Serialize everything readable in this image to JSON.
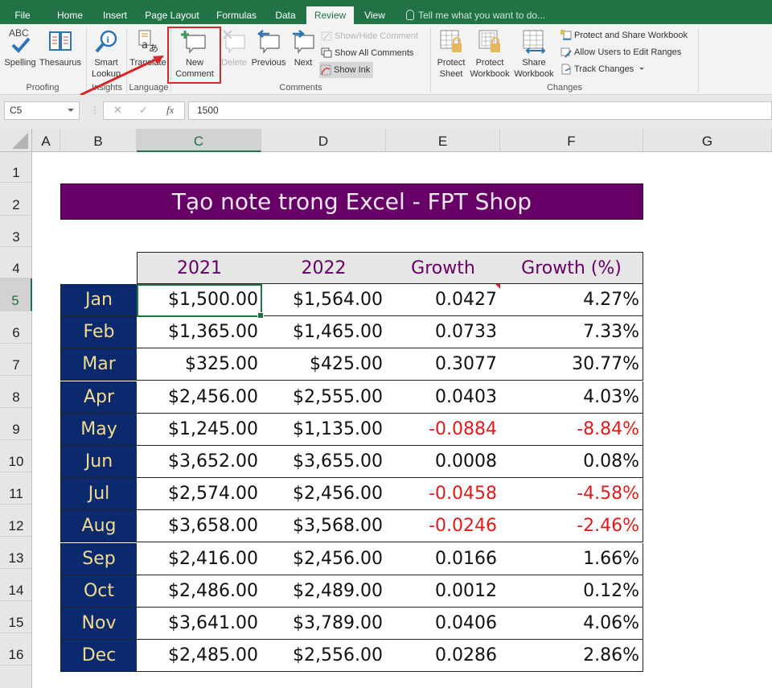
{
  "ribbon_tabs": [
    {
      "label": "File",
      "active": false
    },
    {
      "label": "Home",
      "active": false
    },
    {
      "label": "Insert",
      "active": false
    },
    {
      "label": "Page Layout",
      "active": false
    },
    {
      "label": "Formulas",
      "active": false
    },
    {
      "label": "Data",
      "active": false
    },
    {
      "label": "Review",
      "active": true
    },
    {
      "label": "View",
      "active": false
    }
  ],
  "tell_me": "Tell me what you want to do...",
  "ribbon": {
    "proofing": {
      "label": "Proofing",
      "spelling": "Spelling",
      "abc": "ABC",
      "thesaurus": "Thesaurus"
    },
    "insights": {
      "label": "Insights",
      "smart_lookup_1": "Smart",
      "smart_lookup_2": "Lookup"
    },
    "language": {
      "label": "Language",
      "translate": "Translate"
    },
    "comments": {
      "label": "Comments",
      "new_comment_1": "New",
      "new_comment_2": "Comment",
      "delete": "Delete",
      "previous": "Previous",
      "next": "Next",
      "show_hide": "Show/Hide Comment",
      "show_all": "Show All Comments",
      "show_ink": "Show Ink"
    },
    "changes": {
      "label": "Changes",
      "protect_sheet_1": "Protect",
      "protect_sheet_2": "Sheet",
      "protect_workbook_1": "Protect",
      "protect_workbook_2": "Workbook",
      "share_workbook_1": "Share",
      "share_workbook_2": "Workbook",
      "protect_share": "Protect and Share Workbook",
      "allow_users": "Allow Users to Edit Ranges",
      "track_changes": "Track Changes"
    }
  },
  "formula_bar": {
    "name_box": "C5",
    "cancel": "✕",
    "enter": "✓",
    "fx": "fx",
    "value": "1500"
  },
  "columns": [
    "A",
    "B",
    "C",
    "D",
    "E",
    "F",
    "G"
  ],
  "selected_column": "C",
  "rows": [
    "1",
    "2",
    "3",
    "4",
    "5",
    "6",
    "7",
    "8",
    "9",
    "10",
    "11",
    "12",
    "13",
    "14",
    "15",
    "16"
  ],
  "selected_row": "5",
  "sheet": {
    "title": "Tạo note trong Excel - FPT Shop",
    "headers": [
      "2021",
      "2022",
      "Growth",
      "Growth (%)"
    ],
    "data": [
      {
        "month": "Jan",
        "y2021": "$1,500.00",
        "y2022": "$1,564.00",
        "growth": "0.0427",
        "growth_pct": "4.27%",
        "negative": false
      },
      {
        "month": "Feb",
        "y2021": "$1,365.00",
        "y2022": "$1,465.00",
        "growth": "0.0733",
        "growth_pct": "7.33%",
        "negative": false
      },
      {
        "month": "Mar",
        "y2021": "$325.00",
        "y2022": "$425.00",
        "growth": "0.3077",
        "growth_pct": "30.77%",
        "negative": false
      },
      {
        "month": "Apr",
        "y2021": "$2,456.00",
        "y2022": "$2,555.00",
        "growth": "0.0403",
        "growth_pct": "4.03%",
        "negative": false
      },
      {
        "month": "May",
        "y2021": "$1,245.00",
        "y2022": "$1,135.00",
        "growth": "-0.0884",
        "growth_pct": "-8.84%",
        "negative": true
      },
      {
        "month": "Jun",
        "y2021": "$3,652.00",
        "y2022": "$3,655.00",
        "growth": "0.0008",
        "growth_pct": "0.08%",
        "negative": false
      },
      {
        "month": "Jul",
        "y2021": "$2,574.00",
        "y2022": "$2,456.00",
        "growth": "-0.0458",
        "growth_pct": "-4.58%",
        "negative": true
      },
      {
        "month": "Aug",
        "y2021": "$3,658.00",
        "y2022": "$3,568.00",
        "growth": "-0.0246",
        "growth_pct": "-2.46%",
        "negative": true
      },
      {
        "month": "Sep",
        "y2021": "$2,416.00",
        "y2022": "$2,456.00",
        "growth": "0.0166",
        "growth_pct": "1.66%",
        "negative": false
      },
      {
        "month": "Oct",
        "y2021": "$2,486.00",
        "y2022": "$2,489.00",
        "growth": "0.0012",
        "growth_pct": "0.12%",
        "negative": false
      },
      {
        "month": "Nov",
        "y2021": "$3,641.00",
        "y2022": "$3,789.00",
        "growth": "0.0406",
        "growth_pct": "4.06%",
        "negative": false
      },
      {
        "month": "Dec",
        "y2021": "$2,485.00",
        "y2022": "$2,556.00",
        "growth": "0.0286",
        "growth_pct": "2.86%",
        "negative": false
      }
    ]
  },
  "colors": {
    "excel_green": "#217346",
    "title_bg": "#660066",
    "month_bg": "#0b2a6e",
    "month_text": "#f3dc8f",
    "header_text": "#660066",
    "negative": "#e01b1b",
    "highlight_box": "#d9262b"
  }
}
